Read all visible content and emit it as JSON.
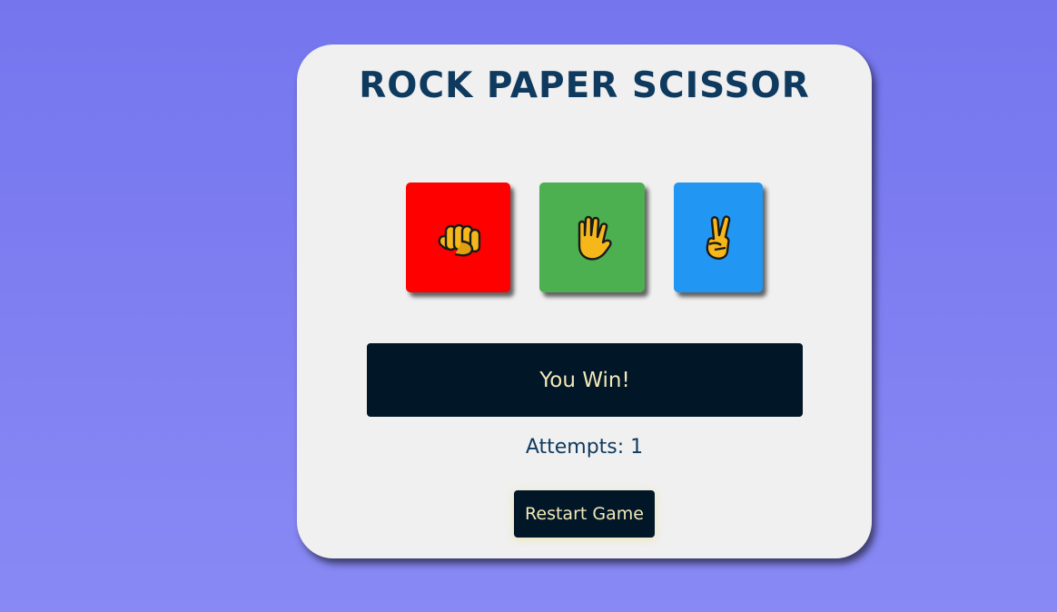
{
  "game": {
    "title": "ROCK PAPER SCISSOR",
    "choices": [
      {
        "name": "rock",
        "icon": "fist-icon",
        "color": "#ff0000"
      },
      {
        "name": "paper",
        "icon": "raised-hand-icon",
        "color": "#4caf50"
      },
      {
        "name": "scissors",
        "icon": "victory-hand-icon",
        "color": "#2196f3"
      }
    ],
    "result_text": "You Win!",
    "attempts_text": "Attempts: 1",
    "restart_label": "Restart Game"
  },
  "colors": {
    "background_top": "#7575ee",
    "background_bottom": "#8989f5",
    "card": "#f0f0f0",
    "title": "#0f3a5f",
    "result_bg": "#011627",
    "result_text": "#f4e9b8"
  }
}
